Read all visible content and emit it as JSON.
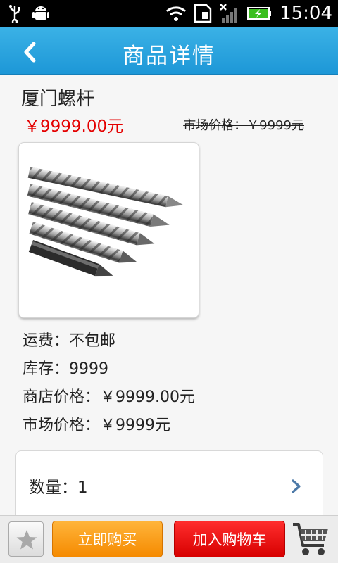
{
  "status_bar": {
    "time": "15:04",
    "icons": [
      "usb-icon",
      "android-debug-icon",
      "wifi-icon",
      "sd-card-icon",
      "no-signal-icon",
      "battery-charging-icon"
    ]
  },
  "header": {
    "title": "商品详情",
    "back_icon": "back-arrow-icon"
  },
  "product": {
    "name": "厦门螺杆",
    "price": "￥9999.00元",
    "market_price_top": "市场价格：￥9999元",
    "image_icon": "product-screws-image"
  },
  "details": {
    "shipping": "运费：不包邮",
    "stock": "库存：9999",
    "store_price": "商店价格：￥9999.00元",
    "market_price": "市场价格：￥9999元"
  },
  "quantity": {
    "label": "数量：1",
    "chevron_icon": "chevron-right-icon"
  },
  "bottom_bar": {
    "favorite_icon": "star-icon",
    "buy_now_label": "立即购买",
    "add_to_cart_label": "加入购物车",
    "cart_icon": "shopping-cart-icon"
  },
  "colors": {
    "header_blue": "#1d97d7",
    "price_red": "#e40000",
    "buy_orange": "#f58a00",
    "cart_red": "#d70000"
  }
}
